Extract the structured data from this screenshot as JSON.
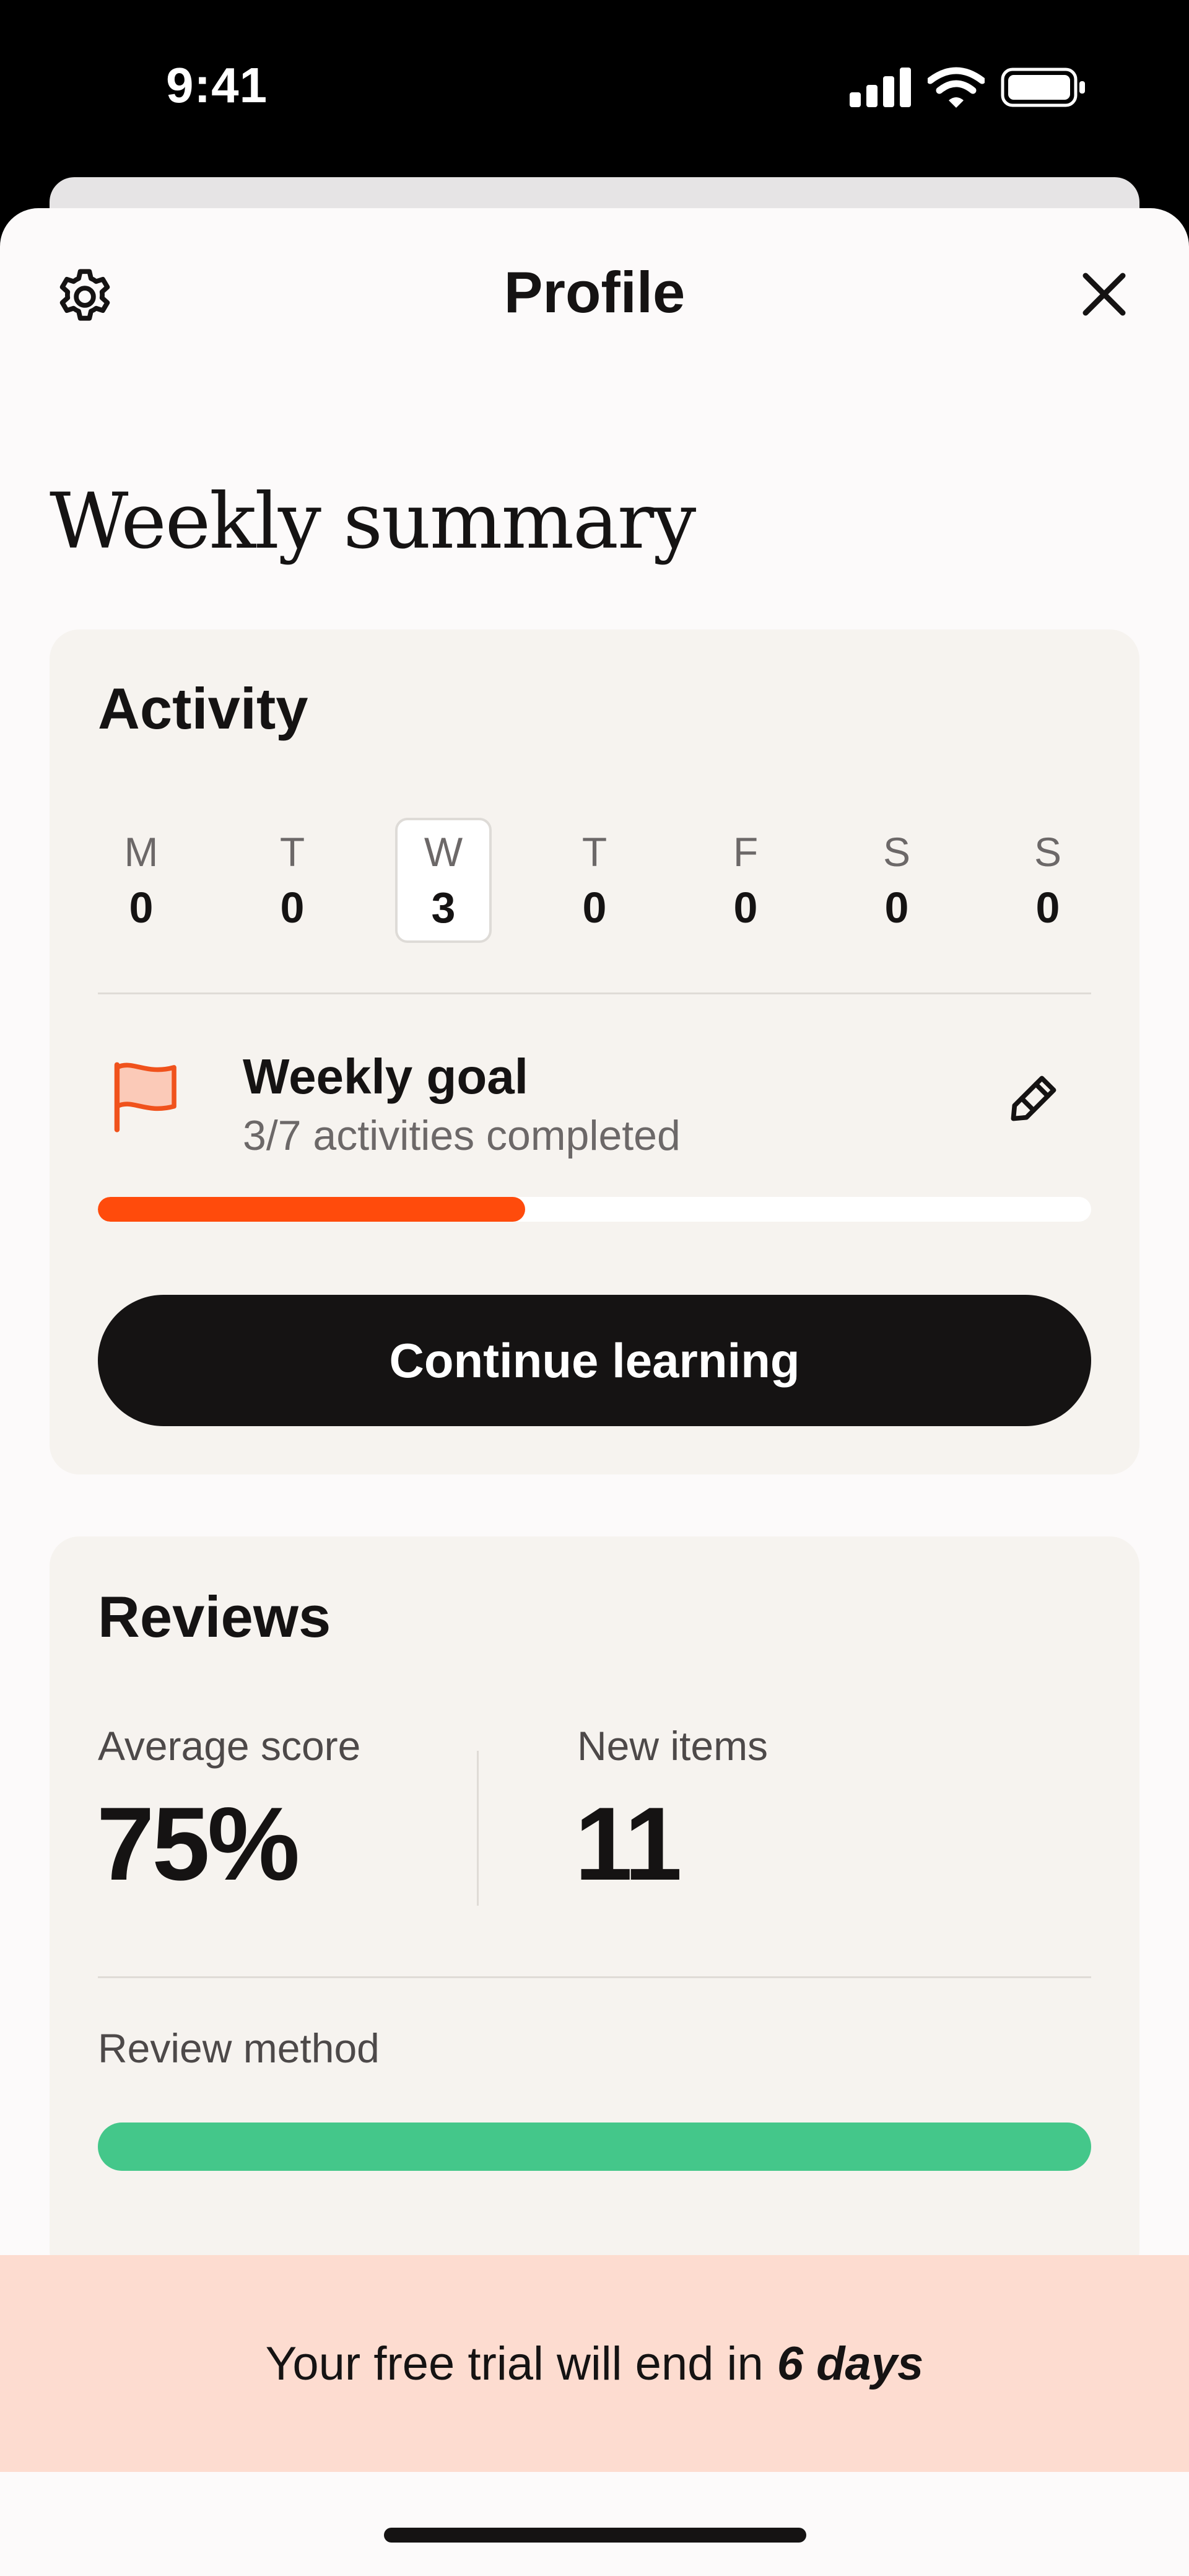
{
  "status_bar": {
    "time": "9:41"
  },
  "header": {
    "title": "Profile"
  },
  "weekly_summary": {
    "title": "Weekly summary"
  },
  "activity": {
    "title": "Activity",
    "days": [
      {
        "letter": "M",
        "count": "0"
      },
      {
        "letter": "T",
        "count": "0"
      },
      {
        "letter": "W",
        "count": "3"
      },
      {
        "letter": "T",
        "count": "0"
      },
      {
        "letter": "F",
        "count": "0"
      },
      {
        "letter": "S",
        "count": "0"
      },
      {
        "letter": "S",
        "count": "0"
      }
    ],
    "selected_day": "W",
    "goal_title": "Weekly goal",
    "goal_progress": "3/7 activities completed",
    "goal_fraction": 0.43,
    "continue_label": "Continue learning"
  },
  "reviews": {
    "title": "Reviews",
    "average_score_label": "Average score",
    "average_score_value": "75%",
    "new_items_label": "New items",
    "new_items_value": "11",
    "review_method_label": "Review method"
  },
  "trial_banner": {
    "text": "Your free trial will end in",
    "days": "6 days"
  },
  "colors": {
    "accent_orange": "#ff4b0c",
    "accent_green": "#44c78a",
    "banner_bg": "#fddcd0",
    "card_bg": "#f6f3ef",
    "button_bg": "#151313"
  },
  "icons": [
    "gear-icon",
    "close-icon",
    "flag-icon",
    "pencil-icon",
    "signal-icon",
    "wifi-icon",
    "battery-icon"
  ]
}
